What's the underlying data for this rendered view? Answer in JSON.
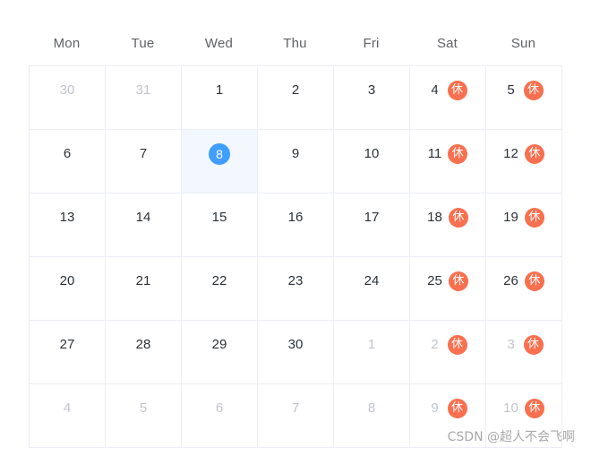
{
  "header": {
    "weekdays": [
      "Mon",
      "Tue",
      "Wed",
      "Thu",
      "Fri",
      "Sat",
      "Sun"
    ]
  },
  "colors": {
    "selected_circle": "#409eff",
    "selected_cell_bg": "#f2f8fe",
    "rest_badge_bg": "#f8704f",
    "border": "#ebeef5",
    "day_text": "#2c3238",
    "other_month_text": "#c0c4cc",
    "weekday_header_text": "#606266"
  },
  "badges": {
    "rest_label": "休"
  },
  "watermark": {
    "text": "CSDN @超人不会飞啊"
  },
  "weeks": [
    {
      "days": [
        {
          "num": "30",
          "other_month": true,
          "selected": false,
          "rest": false
        },
        {
          "num": "31",
          "other_month": true,
          "selected": false,
          "rest": false
        },
        {
          "num": "1",
          "other_month": false,
          "selected": false,
          "rest": false
        },
        {
          "num": "2",
          "other_month": false,
          "selected": false,
          "rest": false
        },
        {
          "num": "3",
          "other_month": false,
          "selected": false,
          "rest": false
        },
        {
          "num": "4",
          "other_month": false,
          "selected": false,
          "rest": true
        },
        {
          "num": "5",
          "other_month": false,
          "selected": false,
          "rest": true
        }
      ]
    },
    {
      "days": [
        {
          "num": "6",
          "other_month": false,
          "selected": false,
          "rest": false
        },
        {
          "num": "7",
          "other_month": false,
          "selected": false,
          "rest": false
        },
        {
          "num": "8",
          "other_month": false,
          "selected": true,
          "rest": false
        },
        {
          "num": "9",
          "other_month": false,
          "selected": false,
          "rest": false
        },
        {
          "num": "10",
          "other_month": false,
          "selected": false,
          "rest": false
        },
        {
          "num": "11",
          "other_month": false,
          "selected": false,
          "rest": true
        },
        {
          "num": "12",
          "other_month": false,
          "selected": false,
          "rest": true
        }
      ]
    },
    {
      "days": [
        {
          "num": "13",
          "other_month": false,
          "selected": false,
          "rest": false
        },
        {
          "num": "14",
          "other_month": false,
          "selected": false,
          "rest": false
        },
        {
          "num": "15",
          "other_month": false,
          "selected": false,
          "rest": false
        },
        {
          "num": "16",
          "other_month": false,
          "selected": false,
          "rest": false
        },
        {
          "num": "17",
          "other_month": false,
          "selected": false,
          "rest": false
        },
        {
          "num": "18",
          "other_month": false,
          "selected": false,
          "rest": true
        },
        {
          "num": "19",
          "other_month": false,
          "selected": false,
          "rest": true
        }
      ]
    },
    {
      "days": [
        {
          "num": "20",
          "other_month": false,
          "selected": false,
          "rest": false
        },
        {
          "num": "21",
          "other_month": false,
          "selected": false,
          "rest": false
        },
        {
          "num": "22",
          "other_month": false,
          "selected": false,
          "rest": false
        },
        {
          "num": "23",
          "other_month": false,
          "selected": false,
          "rest": false
        },
        {
          "num": "24",
          "other_month": false,
          "selected": false,
          "rest": false
        },
        {
          "num": "25",
          "other_month": false,
          "selected": false,
          "rest": true
        },
        {
          "num": "26",
          "other_month": false,
          "selected": false,
          "rest": true
        }
      ]
    },
    {
      "days": [
        {
          "num": "27",
          "other_month": false,
          "selected": false,
          "rest": false
        },
        {
          "num": "28",
          "other_month": false,
          "selected": false,
          "rest": false
        },
        {
          "num": "29",
          "other_month": false,
          "selected": false,
          "rest": false
        },
        {
          "num": "30",
          "other_month": false,
          "selected": false,
          "rest": false
        },
        {
          "num": "1",
          "other_month": true,
          "selected": false,
          "rest": false
        },
        {
          "num": "2",
          "other_month": true,
          "selected": false,
          "rest": true
        },
        {
          "num": "3",
          "other_month": true,
          "selected": false,
          "rest": true
        }
      ]
    },
    {
      "days": [
        {
          "num": "4",
          "other_month": true,
          "selected": false,
          "rest": false
        },
        {
          "num": "5",
          "other_month": true,
          "selected": false,
          "rest": false
        },
        {
          "num": "6",
          "other_month": true,
          "selected": false,
          "rest": false
        },
        {
          "num": "7",
          "other_month": true,
          "selected": false,
          "rest": false
        },
        {
          "num": "8",
          "other_month": true,
          "selected": false,
          "rest": false
        },
        {
          "num": "9",
          "other_month": true,
          "selected": false,
          "rest": true
        },
        {
          "num": "10",
          "other_month": true,
          "selected": false,
          "rest": true
        }
      ]
    }
  ]
}
